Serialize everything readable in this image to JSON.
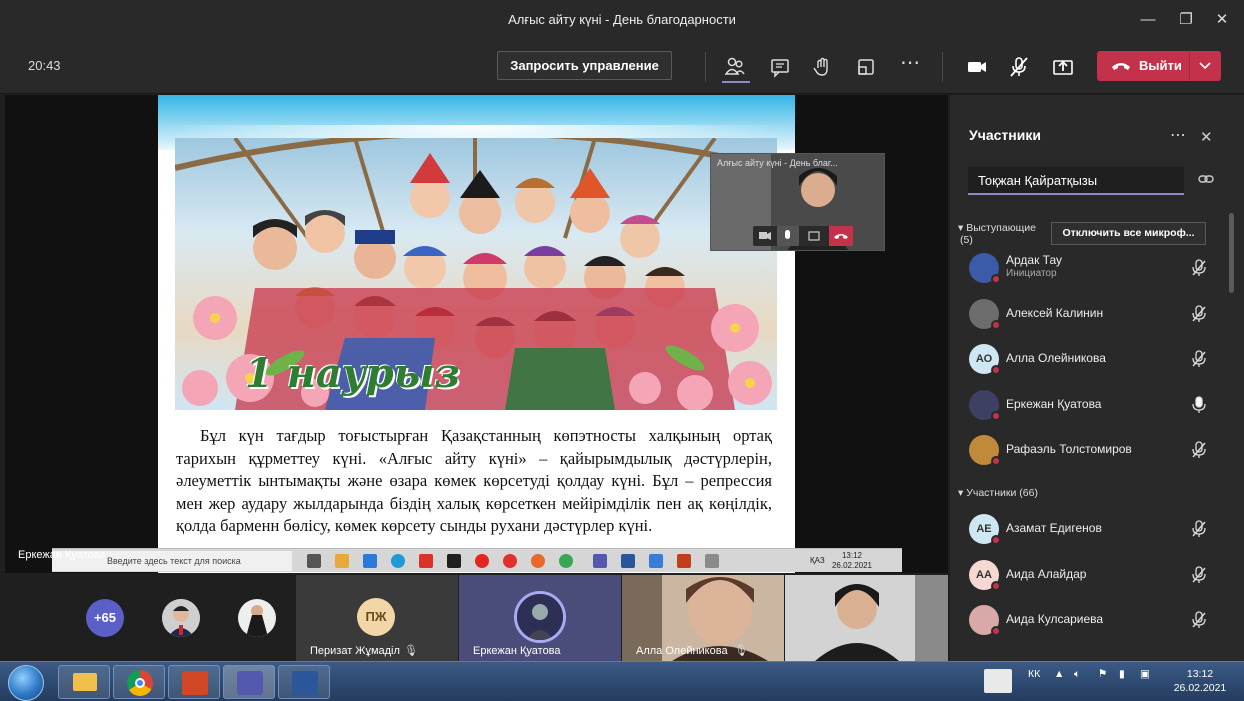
{
  "window": {
    "title": "Алғыс айту күні - День благодарности"
  },
  "toolbar": {
    "elapsed": "20:43",
    "request_control": "Запросить управление",
    "leave_label": "Выйти"
  },
  "slide": {
    "banner_text": "1 наурыз",
    "body": "Бұл күн тағдыр тоғыстырған Қазақстанның көпэтносты халқының ортақ тарихын құрметтеу күні. «Алғыс айту күні» – қайырымдылық дәстүрлерін, әлеуметтік ынтымақты және өзара көмек көрсетуді қолдау күні. Бұл – репрессия мен жер аудару жылдарында біздің халық көрсеткен мейірімділік пен ақ көңілдік, қолда барменн бөлісу, көмек көрсету сынды рухани дәстүрлер күні."
  },
  "pip": {
    "caption": "Алғыс айту күні - День благ..."
  },
  "stage": {
    "presenter_label": "Еркежан Қуатова"
  },
  "inner_taskbar": {
    "search_placeholder": "Введите здесь текст для поиска",
    "lang": "ҚАЗ",
    "time": "13:12",
    "date": "26.02.2021"
  },
  "panel": {
    "title": "Участники",
    "search_value": "Тоқжан Қайратқызы",
    "presenters_section": "Выступающие",
    "presenters_count": "(5)",
    "mute_all": "Отключить все микроф...",
    "attendees_section": "Участники (66)",
    "presenters": [
      {
        "name": "Ардак Тау",
        "role": "Инициатор",
        "initials": "",
        "avatar_color": "#3b5aa8",
        "mic": "muted"
      },
      {
        "name": "Алексей Калинин",
        "initials": "",
        "avatar_color": "#6d6d6d",
        "mic": "muted"
      },
      {
        "name": "Алла Олейникова",
        "initials": "АО",
        "avatar_color": "#cfe7f2",
        "mic": "muted"
      },
      {
        "name": "Еркежан Қуатова",
        "initials": "",
        "avatar_color": "#3d3f63",
        "mic": "on"
      },
      {
        "name": "Рафаэль Толстомиров",
        "initials": "",
        "avatar_color": "#c08a3a",
        "mic": "muted"
      }
    ],
    "attendees": [
      {
        "name": "Азамат Едигенов",
        "initials": "АЕ",
        "avatar_color": "#cfe7f2",
        "mic": "muted"
      },
      {
        "name": "Аида Алайдар",
        "initials": "АА",
        "avatar_color": "#f6d8d2",
        "mic": "muted"
      },
      {
        "name": "Аида Кулсариева",
        "initials": "",
        "avatar_color": "#d9a8a8",
        "mic": "muted"
      }
    ]
  },
  "strip": {
    "overflow_count": "+65",
    "tiles": [
      {
        "name": "Перизат Жұмаділ",
        "initials": "ПЖ"
      },
      {
        "name": "Еркежан Қуатова"
      },
      {
        "name": "Алла Олейникова"
      }
    ]
  },
  "taskbar": {
    "lang": "КК",
    "time": "13:12",
    "date": "26.02.2021"
  }
}
